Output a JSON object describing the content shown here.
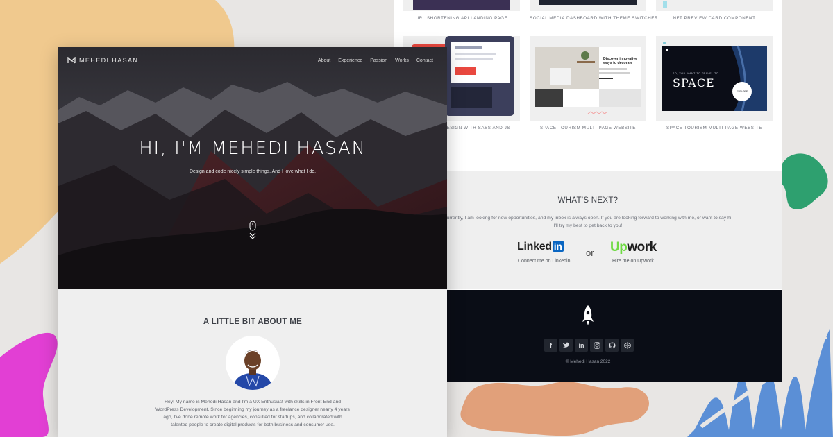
{
  "colors": {
    "background": "#e8e6e4",
    "accent_orange_blob": "#f0c98e",
    "accent_green_blob": "#2ea06f",
    "accent_magenta_blob": "#e23fd4",
    "accent_blue_shape": "#5b8fd6",
    "accent_peach_blob": "#e1a07a",
    "footer_bg": "#0a0d16",
    "linkedin_blue": "#0a66c2",
    "upwork_green": "#6fda44"
  },
  "header": {
    "logo_icon": "m-monogram-icon",
    "brand": "MEHEDI HASAN",
    "nav": [
      "About",
      "Experience",
      "Passion",
      "Works",
      "Contact"
    ]
  },
  "hero": {
    "title": "HI, I'M MEHEDI HASAN",
    "subtitle": "Design and code nicely simple things. And I love what I do.",
    "scroll_icon": "mouse-scroll-icon"
  },
  "about": {
    "title": "A LITTLE BIT ABOUT ME",
    "avatar_icon": "profile-photo",
    "bio": "Hey! My name is Mehedi Hasan and I'm a UX Enthusiast with skills in Front-End and WordPress Development. Since beginning my journey as a freelance designer nearly 4 years ago, I've done remote work for agencies, consulted for startups, and collaborated with talented people to create digital products for both business and consumer use."
  },
  "works": {
    "row1_captions": [
      "URL SHORTENING API LANDING PAGE",
      "SOCIAL MEDIA DASHBOARD WITH THEME SWITCHER",
      "NFT PREVIEW CARD COMPONENT"
    ],
    "row2_captions": [
      "PAGE DESIGN WITH SASS AND JS",
      "SPACE TOURISM MULTI-PAGE WEBSITE",
      "SPACE TOURISM MULTI-PAGE WEBSITE"
    ],
    "room_heading": "Discover innovative ways to decorate",
    "space_heading": "SPACE",
    "space_kicker": "SO, YOU WANT TO TRAVEL TO",
    "space_button": "EXPLORE"
  },
  "next": {
    "title": "WHAT'S NEXT?",
    "text": "Currently, I am looking for new opportunities, and my inbox is always open. If you are looking forward to working with me, or want to say hi, I'll try my best to get back to you!",
    "linkedin_word": "Linked",
    "linkedin_box": "in",
    "linkedin_sub": "Connect me on Linkedin",
    "or": "or",
    "upwork_u": "Up",
    "upwork_rest": "work",
    "upwork_sub": "Hire me on Upwork"
  },
  "footer": {
    "logo_icon": "rocket-icon",
    "socials": [
      "facebook-icon",
      "twitter-icon",
      "linkedin-icon",
      "instagram-icon",
      "github-icon",
      "codepen-icon"
    ],
    "copyright": "© Mehedi Hasan 2022"
  }
}
